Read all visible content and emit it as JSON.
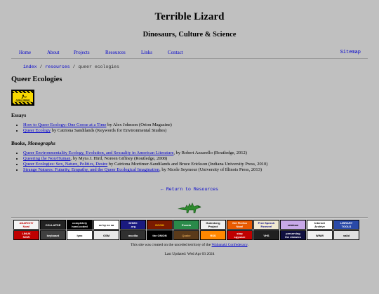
{
  "header": {
    "title": "Terrible Lizard",
    "subtitle": "Dinosaurs, Culture & Science"
  },
  "nav": {
    "items": [
      {
        "label": "Home"
      },
      {
        "label": "About"
      },
      {
        "label": "Projects"
      },
      {
        "label": "Resources"
      },
      {
        "label": "Links"
      },
      {
        "label": "Contact"
      }
    ],
    "sitemap": "Sitemap"
  },
  "breadcrumb": {
    "index": "index",
    "sep": "/",
    "resources": "resources",
    "current": "queer ecologies"
  },
  "page": {
    "title": "Queer Ecologies",
    "construction_text": "AREA UNDER CONSTRUCTION"
  },
  "essays": {
    "heading": "Essays",
    "items": [
      {
        "link": "How to Queer Ecology: One Goose at a Time",
        "rest": " by Alex Johnson (Orion Magazine)"
      },
      {
        "link": "Queer Ecology",
        "rest": " by Catriona Sandilands (Keywords for Environmental Studies)"
      }
    ]
  },
  "books": {
    "heading_plain": "Books, ",
    "heading_italic": "Monographs",
    "items": [
      {
        "link": "Queer Environmentality Ecology, Evolution, and Sexuality in American Literature",
        "rest": ", by Robert Azzarello (Routledge, 2012)"
      },
      {
        "link": "Queering the Non/Human",
        "rest": ", by Myra J. Hird, Noreen Giffney (Routledge, 2008)"
      },
      {
        "link": "Queer Ecologies: Sex, Nature, Politics, Desire",
        "rest": " by Catriona Mortimer-Sandilands and Bruce Erickson (Indiana University Press, 2010)"
      },
      {
        "link": "Strange Natures: Futurity, Empathy, and the Queer Ecological Imagination",
        "rest": ", by Nicole Seymour (University of Illinois Press, 2013)"
      }
    ]
  },
  "return_link": "← Return to Resources",
  "badges": {
    "row1": [
      {
        "label": "ANARCHY\nNow!",
        "bg": "#f4f4f4",
        "fg": "#c00000"
      },
      {
        "label": "COLLAPSE",
        "bg": "#222222",
        "fg": "#ffffff"
      },
      {
        "label": "completely\nhand-coded",
        "bg": "#000000",
        "fg": "#ffffff"
      },
      {
        "label": "cc by nc sa",
        "bg": "#ffffff",
        "fg": "#000000"
      },
      {
        "label": "DHMO\n.org",
        "bg": "#1a1a80",
        "fg": "#ffffff"
      },
      {
        "label": "DOOM",
        "bg": "#7a1a00",
        "fg": "#ffcc00"
      },
      {
        "label": "Ecosia",
        "bg": "#2a8a4a",
        "fg": "#ffffff"
      },
      {
        "label": "Gutenberg\nProject",
        "bg": "#f0f0f0",
        "fg": "#000000"
      },
      {
        "label": "Get Firefox\nNow!",
        "bg": "#e85a00",
        "fg": "#ffffff"
      },
      {
        "label": "Free Speech\nForever!",
        "bg": "#f0e8d0",
        "fg": "#000080"
      },
      {
        "label": "rainbow",
        "bg": "#c8a8e8",
        "fg": "#000000"
      },
      {
        "label": "Internet\nArchive",
        "bg": "#ffffff",
        "fg": "#000000"
      },
      {
        "label": "LIBRARY\nTOOLS",
        "bg": "#2a4aa8",
        "fg": "#ffffff"
      }
    ],
    "row2": [
      {
        "label": "LINUX\nNOW",
        "bg": "#c00000",
        "fg": "#ffffff"
      },
      {
        "label": "keyboard",
        "bg": "#404040",
        "fg": "#ffffff"
      },
      {
        "label": "lynx",
        "bg": "#ffffff",
        "fg": "#000000"
      },
      {
        "label": "OSM",
        "bg": "#e8e8e8",
        "fg": "#000000"
      },
      {
        "label": "mozilla",
        "bg": "#303030",
        "fg": "#ffffff"
      },
      {
        "label": "the ONION",
        "bg": "#000000",
        "fg": "#ffffff"
      },
      {
        "label": "Quake",
        "bg": "#5a3a1a",
        "fg": "#d8a050"
      },
      {
        "label": "RSS",
        "bg": "#ff8800",
        "fg": "#ffffff"
      },
      {
        "label": "stop\nspyware",
        "bg": "#c00000",
        "fg": "#ffffff"
      },
      {
        "label": "VHS",
        "bg": "#202020",
        "fg": "#ffffff"
      },
      {
        "label": "preserving\nthe classics",
        "bg": "#101040",
        "fg": "#ffffff"
      },
      {
        "label": "WWW",
        "bg": "#f0f0f0",
        "fg": "#000000"
      },
      {
        "label": "valid",
        "bg": "#e0e0e0",
        "fg": "#000000"
      }
    ]
  },
  "footer": {
    "ack_pre": "This site was created on the unceded territory of the ",
    "ack_link": "Wabanaki Confederacy",
    "ack_post": ".",
    "updated": "Last Updated: Wed Apr 03 2024"
  }
}
